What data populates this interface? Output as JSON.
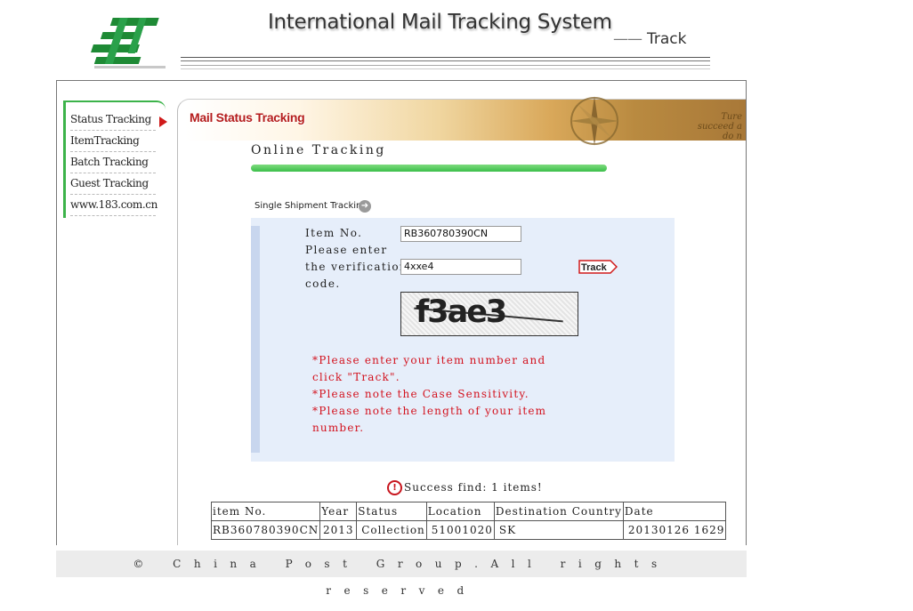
{
  "header": {
    "title": "International Mail Tracking System",
    "dash": "——",
    "subtitle": "Track"
  },
  "sidebar": {
    "items": [
      {
        "label": "Status Tracking",
        "active": true
      },
      {
        "label": "ItemTracking"
      },
      {
        "label": "Batch Tracking"
      },
      {
        "label": "Guest Tracking"
      },
      {
        "label": "www.183.com.cn"
      }
    ]
  },
  "banner": {
    "title": "Mail Status Tracking",
    "script_line1": "Ture",
    "script_line2": "succeed a",
    "script_line3": "do n"
  },
  "section": {
    "title": "Online Tracking",
    "single_label": "Single Shipment Tracking"
  },
  "form": {
    "item_label": "Item No.",
    "item_value": "RB360780390CN",
    "verify_label_1": "Please enter",
    "verify_label_2": "the verification",
    "verify_label_3": "code.",
    "verify_value": "4xxe4",
    "track_button": "Track",
    "captcha_text": "f3ae3"
  },
  "notes": {
    "line1": "*Please enter your item number and",
    "line2": "click \"Track\".",
    "line3": "*Please note the Case Sensitivity.",
    "line4": "*Please note the length of your item",
    "line5": "number."
  },
  "results": {
    "success": "Success find: 1 items!",
    "columns": [
      "item No.",
      "Year",
      "Status",
      "Location",
      "Destination Country",
      "Date"
    ],
    "rows": [
      [
        "RB360780390CN",
        "2013",
        "Collection",
        "51001020",
        "SK",
        "20130126 1629"
      ]
    ]
  },
  "footer": {
    "text": "© China Post Group.All rights reserved"
  },
  "colors": {
    "accent_green": "#3cb34a",
    "brand_red": "#b51d1d",
    "note_red": "#d3121e",
    "panel_blue": "#e6eefa"
  }
}
